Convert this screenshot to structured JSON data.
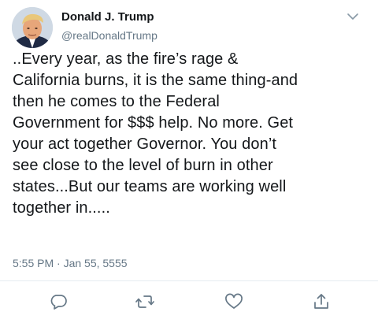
{
  "author": {
    "display_name": "Donald J. Trump",
    "handle": "@realDonaldTrump",
    "avatar_icon": "profile-photo"
  },
  "tweet": {
    "text_lines": [
      "..Every year, as the fire’s rage &",
      "California burns, it is the same thing-and",
      "then he comes to the Federal",
      "Government for $$$ help. No more. Get",
      "your act together Governor. You don’t",
      "see close to the level of burn in other",
      "states...But our teams are working well",
      "together in....."
    ],
    "timestamp": "5:55 PM · Jan 55, 5555"
  },
  "actions": [
    {
      "name": "reply",
      "icon": "speech-bubble-icon"
    },
    {
      "name": "retweet",
      "icon": "retweet-icon"
    },
    {
      "name": "like",
      "icon": "heart-icon"
    },
    {
      "name": "share",
      "icon": "share-icon"
    }
  ],
  "colors": {
    "primary_text": "#14171a",
    "secondary_text": "#657786",
    "divider": "#e6ecf0"
  }
}
